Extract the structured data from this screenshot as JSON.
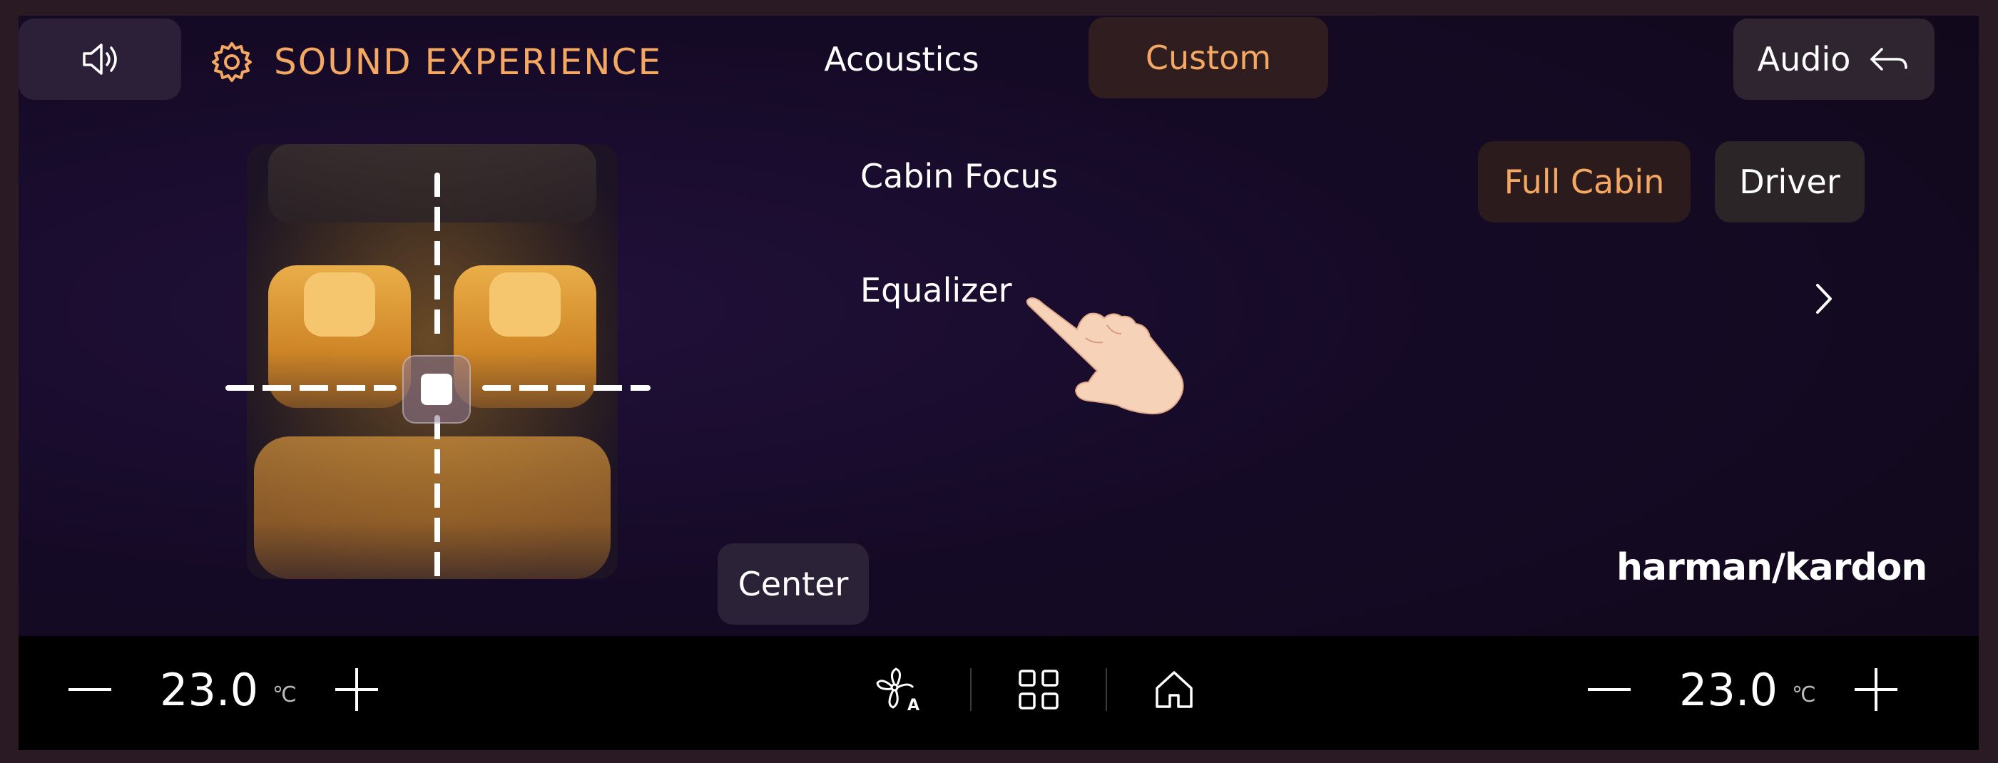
{
  "header": {
    "title": "SOUND EXPERIENCE",
    "tabs": [
      {
        "label": "Acoustics",
        "active": false
      },
      {
        "label": "Custom",
        "active": true
      }
    ],
    "audio_label": "Audio"
  },
  "settings": {
    "cabin_focus_label": "Cabin Focus",
    "cabin_focus_options": [
      "Full Cabin",
      "Driver"
    ],
    "cabin_focus_selected": "Full Cabin",
    "equalizer_label": "Equalizer"
  },
  "cabin_map": {
    "center_label": "Center"
  },
  "brand": "harman/kardon",
  "climate": {
    "left": {
      "temp": "23.0",
      "unit": "℃"
    },
    "right": {
      "temp": "23.0",
      "unit": "℃"
    }
  },
  "colors": {
    "accent": "#f4a861",
    "background": "#150a26",
    "bar": "#000000"
  },
  "icons": [
    "volume-icon",
    "gear-icon",
    "back-arrow-icon",
    "chevron-right-icon",
    "fan-auto-icon",
    "apps-grid-icon",
    "home-icon",
    "minus-icon",
    "plus-icon"
  ]
}
